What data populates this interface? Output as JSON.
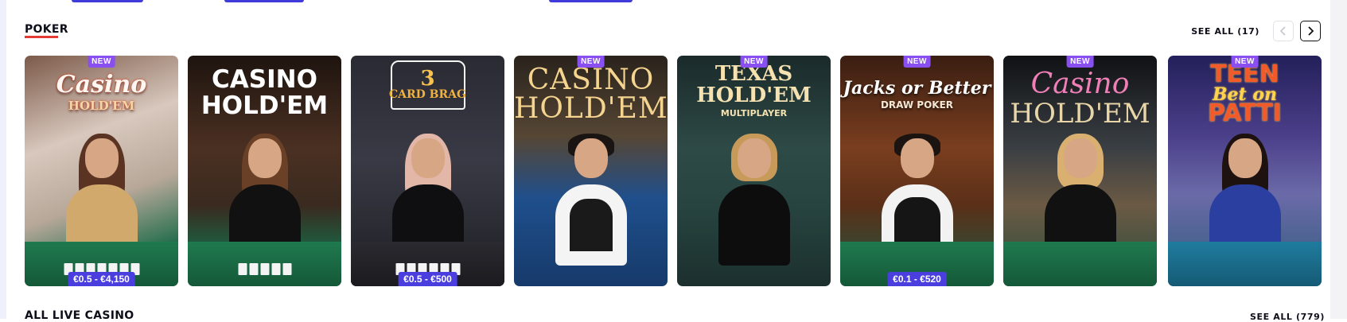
{
  "poker": {
    "title": "POKER",
    "see_all": "SEE ALL (17)",
    "prev_icon": "chevron-left-icon",
    "next_icon": "chevron-right-icon",
    "games": [
      {
        "title": "Casino",
        "subtitle": "HOLD'EM",
        "badge": "NEW",
        "price": "€0.5 - €4,150"
      },
      {
        "title": "CASINO\nHOLD'EM",
        "badge": "",
        "price": ""
      },
      {
        "title": "3",
        "subtitle": "CARD BRAG",
        "badge": "",
        "price": "€0.5 - €500"
      },
      {
        "title": "CASINO\nHOLD'EM",
        "badge": "NEW",
        "price": ""
      },
      {
        "title": "TEXAS\nHOLD'EM",
        "subtitle": "MULTIPLAYER",
        "badge": "NEW",
        "price": ""
      },
      {
        "title": "Jacks or Better",
        "subtitle": "DRAW POKER",
        "badge": "NEW",
        "price": "€0.1 - €520"
      },
      {
        "title": "Casino",
        "subtitle": "HOLD'EM",
        "badge": "NEW",
        "price": ""
      },
      {
        "title": "TEEN",
        "subtitle": "Bet on",
        "extra": "PATTI",
        "badge": "NEW",
        "price": ""
      }
    ]
  },
  "all_live": {
    "title": "ALL LIVE CASINO",
    "see_all": "SEE ALL (779)"
  },
  "colors": {
    "accent_underline": "#e53b35",
    "new_badge": "#8a4ff0",
    "price_badge": "#4a3fde"
  }
}
